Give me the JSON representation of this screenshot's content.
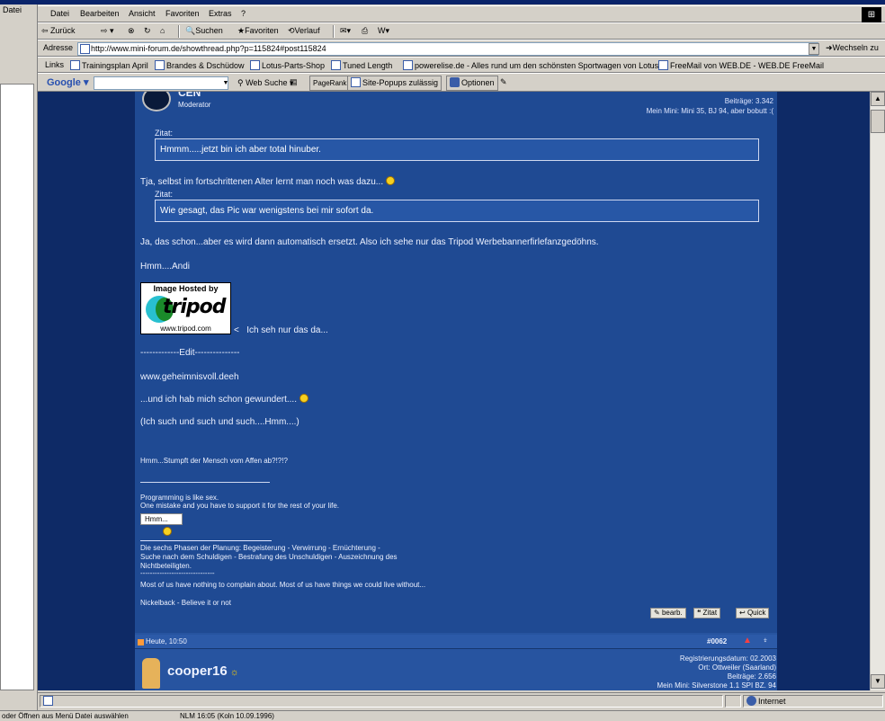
{
  "background_window": {
    "menu": "Datei"
  },
  "browser": {
    "menu": [
      "Datei",
      "Bearbeiten",
      "Ansicht",
      "Favoriten",
      "Extras",
      "?"
    ],
    "toolbar": {
      "back": "Zurück",
      "search": "Suchen",
      "favorites": "Favoriten",
      "history": "Verlauf"
    },
    "address": {
      "label": "Adresse",
      "url": "http://www.mini-forum.de/showthread.php?p=115824#post115824",
      "go": "Wechseln zu"
    },
    "links": {
      "label": "Links",
      "items": [
        "Trainingsplan April",
        "Brandes & Dschüdow",
        "Lotus-Parts-Shop",
        "Tuned Length",
        "powerelise.de - Alles rund um den schönsten Sportwagen von Lotus !",
        "FreeMail von WEB.DE - WEB.DE FreeMail"
      ]
    },
    "google": {
      "logo": "Google",
      "web_search": "Web Suche",
      "pagerank": "PageRank",
      "popups": "Site-Popups zulässig",
      "options": "Optionen"
    }
  },
  "post": {
    "username_partial": "CEN",
    "role": "Moderator",
    "posts_info": "Beiträge: 3.342",
    "car_info": "Mein Mini: Mini 35, BJ 94, aber bobutt :(",
    "quote_label": "Zitat:",
    "quote1": "Hmmm.....jetzt bin ich aber total hinuber.",
    "line1": "Tja, selbst im fortschrittenen Alter lernt man noch was dazu...",
    "quote2_label": "Zitat:",
    "quote2": "Wie gesagt, das Pic war wenigstens bei mir sofort da.",
    "line2": "Ja, das schon...aber es wird dann automatisch ersetzt. Also ich sehe nur das Tripod Werbebannerfirlefanzgedöhns.",
    "line3": "Hmm....Andi",
    "tripod_hosted": "Image Hosted by",
    "tripod_word": "tripod",
    "tripod_url": "www.tripod.com",
    "line4": "Ich seh nur das da...",
    "edit": "-------------Edit---------------",
    "link": "www.geheimnisvoll.deeh",
    "line5": "...und ich hab mich schon gewundert....",
    "line6": "(Ich such und such und such....Hmm....)",
    "sig1": "Hmm...Stumpft der Mensch vom Affen ab?!?!?",
    "sig2a": "Programming is like sex.",
    "sig2b": "One mistake and you have to support it for the rest of your life.",
    "hmm_box": "Hmm...",
    "sig3a": "Die sechs Phasen der Planung: Begeisterung - Verwirrung - Ernüchterung -",
    "sig3b": "Suche nach dem Schuldigen - Bestrafung des Unschuldigen - Auszeichnung des",
    "sig3c": "Nichtbeteiligten.",
    "sig3_sep": "-------------------------------",
    "sig4": "Most of us have nothing to complain about. Most of us have things we could live without...",
    "sig5": "Nickelback - Believe it or not",
    "buttons": [
      "bearb.",
      "Zitat",
      "Quick"
    ]
  },
  "next_post": {
    "date": "Heute, 10:50",
    "number": "#0062",
    "username": "cooper16",
    "reg": "Registrierungsdatum: 02.2003",
    "place": "Ort: Ottweiler (Saarland)",
    "posts": "Beiträge: 2.656",
    "car": "Mein Mini: Silverstone 1.1 SPI BZ. 94"
  },
  "status": {
    "zone": "Internet"
  },
  "bottom": {
    "left": "oder Öffnen aus Menü Datei auswählen",
    "right": "NLM 16:05 (Koln 10.09.1996)"
  }
}
